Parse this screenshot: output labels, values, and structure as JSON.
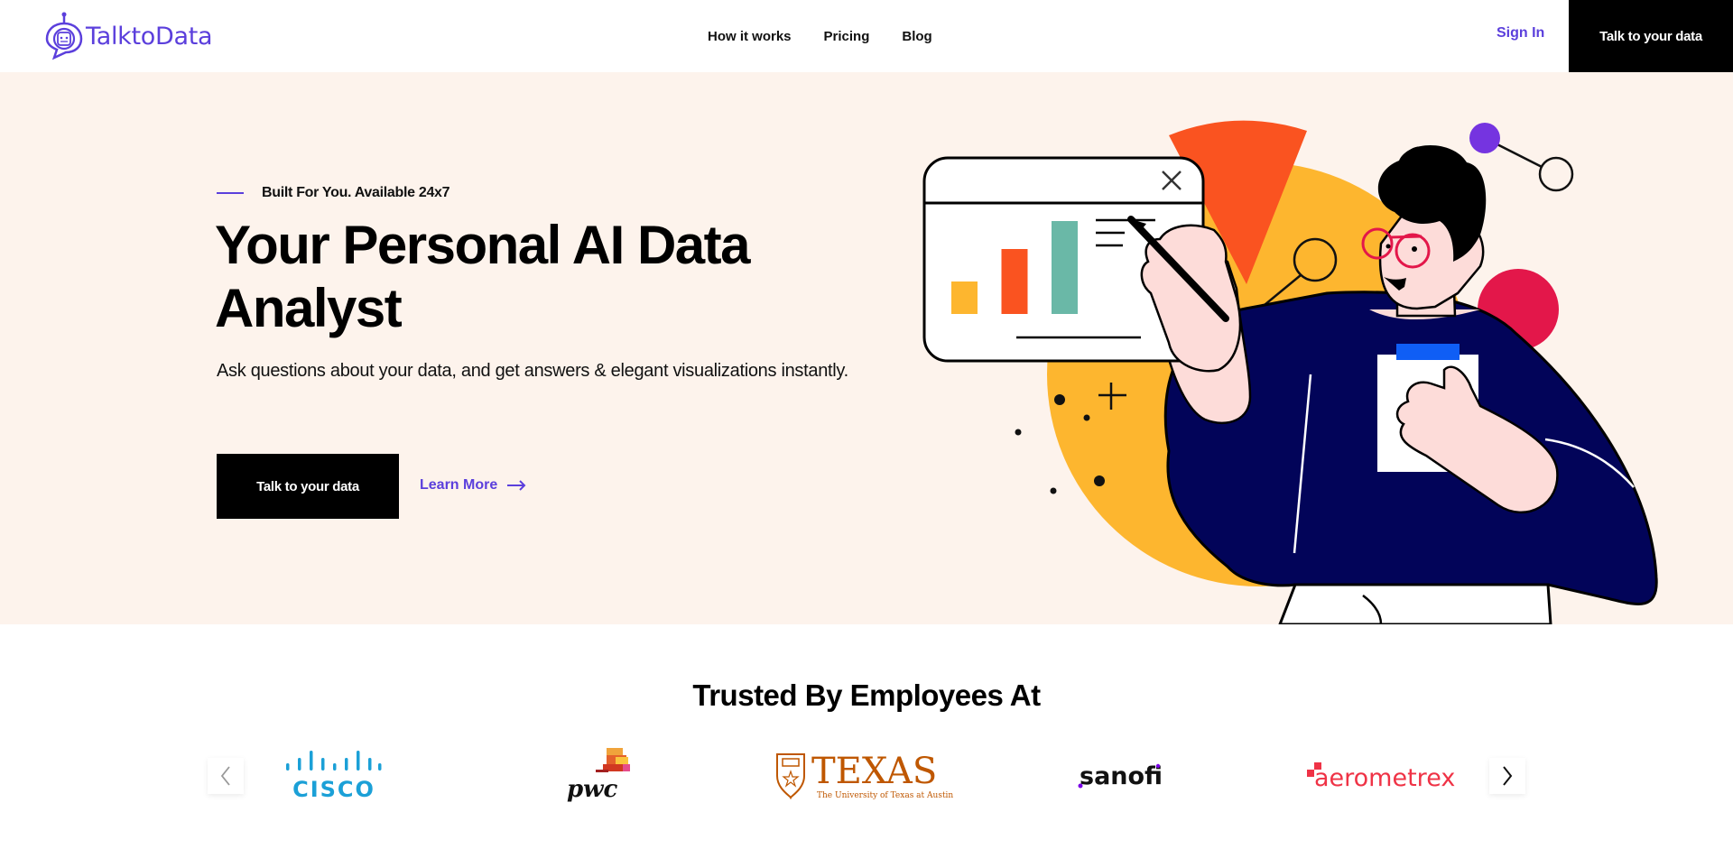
{
  "header": {
    "brand": "TalktoData",
    "nav": [
      {
        "label": "How it works"
      },
      {
        "label": "Pricing"
      },
      {
        "label": "Blog"
      }
    ],
    "sign_in": "Sign In",
    "cta": "Talk to your data"
  },
  "hero": {
    "tagline": "Built For You. Available 24x7",
    "title": "Your Personal AI Data Analyst",
    "subtitle": "Ask questions about your data, and get answers & elegant visualizations instantly.",
    "primary_cta": "Talk to your data",
    "secondary_cta": "Learn More",
    "illustration": {
      "description": "person presenting a bar chart",
      "bar_colors": [
        "#fdb62f",
        "#fa5320",
        "#6ab8a7"
      ]
    }
  },
  "trusted": {
    "title": "Trusted By Employees At",
    "logos": [
      {
        "name": "cisco",
        "text": "CISCO"
      },
      {
        "name": "pwc",
        "text": "pwc"
      },
      {
        "name": "texas",
        "text": "TEXAS",
        "subtext": "The University of Texas at Austin"
      },
      {
        "name": "sanofi",
        "text": "sanofi"
      },
      {
        "name": "aerometrex",
        "text": "aerometrex"
      }
    ]
  },
  "colors": {
    "brand": "#5b3fdc",
    "hero_bg": "#fdf3ec",
    "cta_bg": "#000000"
  }
}
